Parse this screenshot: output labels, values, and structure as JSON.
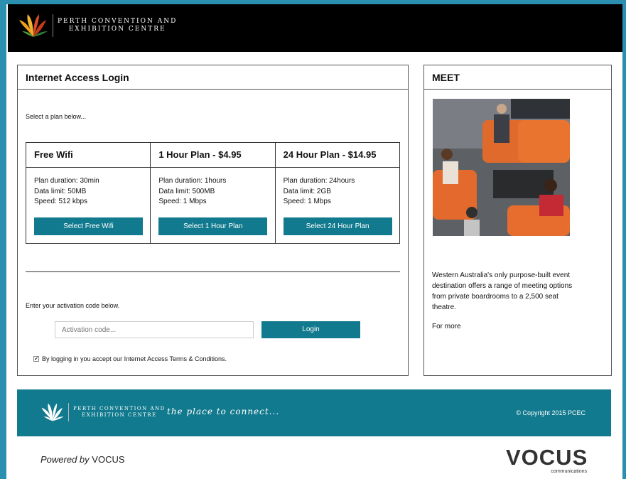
{
  "header": {
    "logo_line1": "PERTH CONVENTION AND",
    "logo_line2": "EXHIBITION CENTRE"
  },
  "main": {
    "title": "Internet Access Login",
    "intro": "Select a plan below...",
    "plans": [
      {
        "name": "Free Wifi",
        "duration": "Plan duration: 30min",
        "data": "Data limit: 50MB",
        "speed": "Speed: 512 kbps",
        "button": "Select Free Wifi"
      },
      {
        "name": "1 Hour Plan - $4.95",
        "duration": "Plan duration: 1hours",
        "data": "Data limit: 500MB",
        "speed": "Speed: 1 Mbps",
        "button": "Select 1 Hour Plan"
      },
      {
        "name": "24 Hour Plan - $14.95",
        "duration": "Plan duration: 24hours",
        "data": "Data limit: 2GB",
        "speed": "Speed: 1 Mbps",
        "button": "Select 24 Hour Plan"
      }
    ],
    "activation_label": "Enter your activation code below.",
    "activation_placeholder": "Activation code...",
    "login_button": "Login",
    "terms_checked": true,
    "terms_text": "By logging in you accept our Internet Access Terms & Conditions."
  },
  "side": {
    "title": "MEET",
    "description": "Western Australia's only purpose-built event destination offers a range of meeting options from private boardrooms to a 2,500 seat theatre.",
    "more": "For more"
  },
  "footer": {
    "logo_line1": "PERTH CONVENTION AND",
    "logo_line2": "EXHIBITION CENTRE",
    "tagline": "the place to connect...",
    "copyright": "© Copyright 2015 PCEC"
  },
  "bottom": {
    "powered_prefix": "Powered by",
    "powered_brand": "VOCUS",
    "vocus_logo": "VOCUS",
    "vocus_sub": "communications"
  },
  "colors": {
    "accent": "#127a8e",
    "frame": "#2b8fb0",
    "header_bg": "#000000"
  }
}
